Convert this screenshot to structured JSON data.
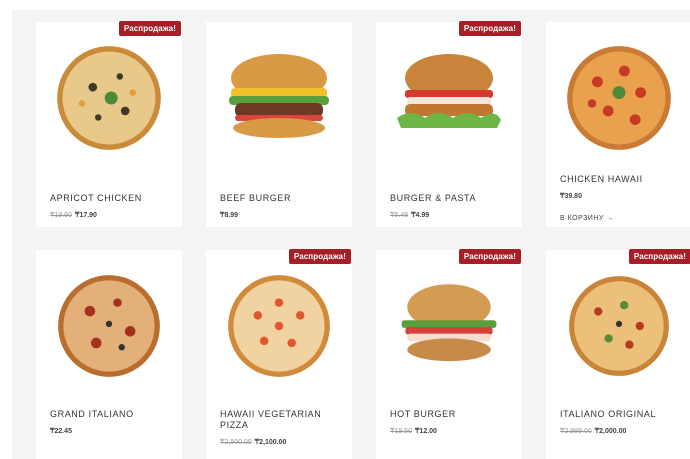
{
  "sale_badge": "Распродажа!",
  "products": [
    {
      "title": "APRICOT CHICKEN",
      "old_price": "₸19.90",
      "price": "₸17.90"
    },
    {
      "title": "BEEF BURGER",
      "price": "₸8.99"
    },
    {
      "title": "BURGER & PASTA",
      "old_price": "₸5.49",
      "price": "₸4.99"
    },
    {
      "title": "CHICKEN HAWAII",
      "price": "₸39.80",
      "cart": "В КОРЗИНУ →"
    },
    {
      "title": "GRAND ITALIANO",
      "price": "₸22.45"
    },
    {
      "title": "HAWAII VEGETARIAN PIZZA",
      "old_price": "₸2,500.00",
      "price": "₸2,100.00"
    },
    {
      "title": "HOT BURGER",
      "old_price": "₸19.50",
      "price": "₸12.00"
    },
    {
      "title": "ITALIANO ORIGINAL",
      "old_price": "₸2,999.00",
      "price": "₸2,000.00"
    }
  ],
  "colors": {
    "sale": "#a61e26"
  },
  "icons": {
    "pizza": "pizza-image",
    "burger": "burger-image"
  }
}
